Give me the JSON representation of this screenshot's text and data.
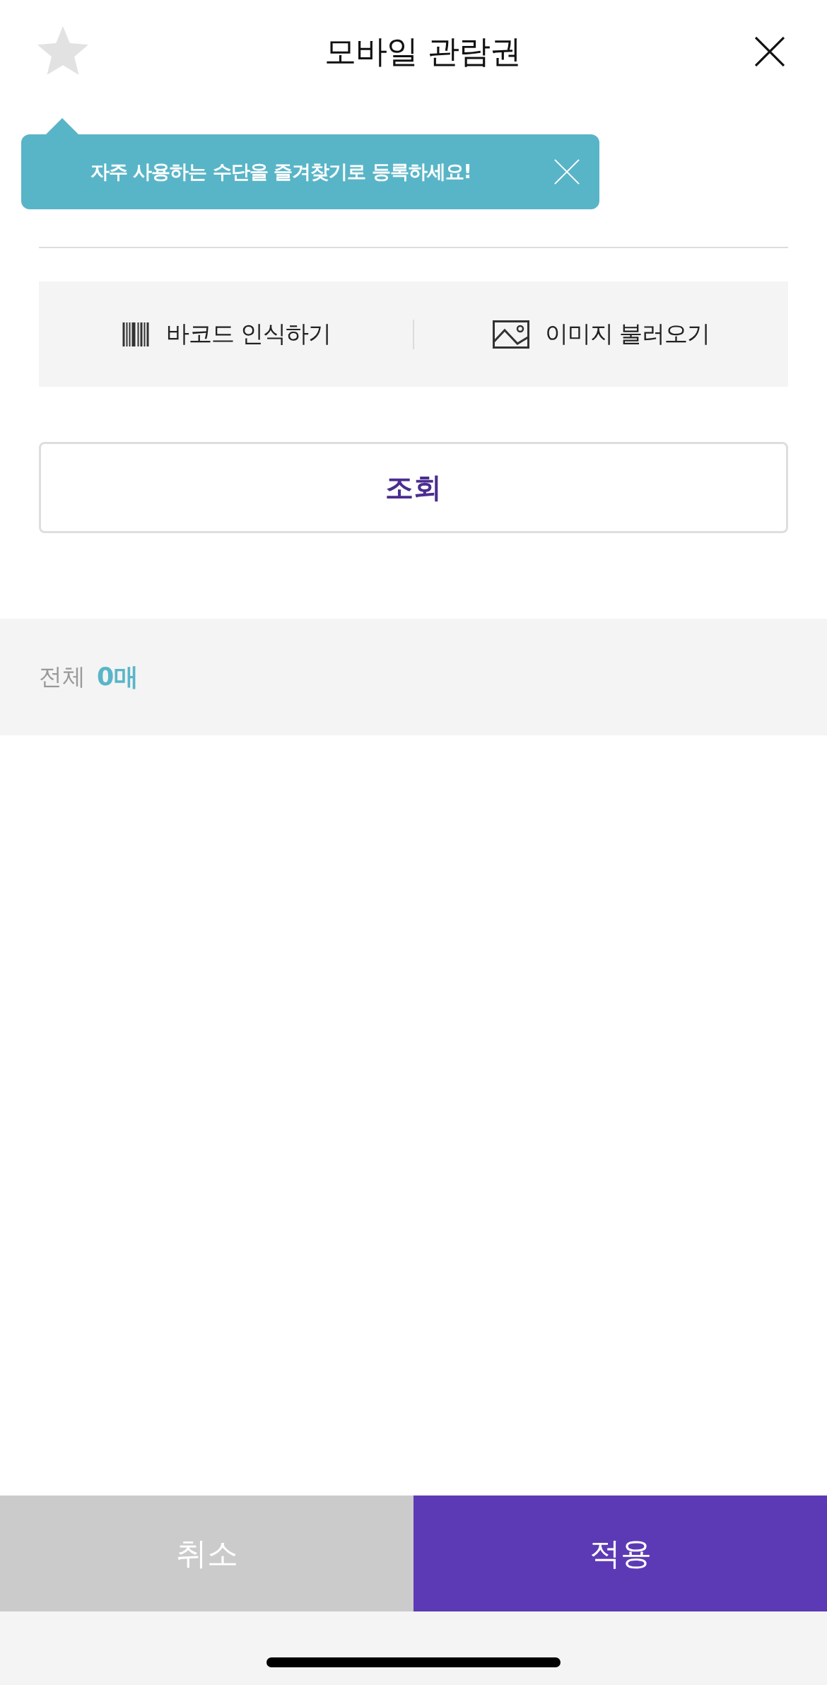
{
  "header": {
    "title": "모바일 관람권",
    "starred": false
  },
  "tooltip": {
    "text": "자주 사용하는 수단을 즐겨찾기로 등록하세요!"
  },
  "actions": [
    {
      "kind": "barcode",
      "label": "바코드 인식하기"
    },
    {
      "kind": "image",
      "label": "이미지 불러오기"
    }
  ],
  "lookup_button": {
    "label": "조회"
  },
  "summary": {
    "label": "전체",
    "count": "0매"
  },
  "footer_buttons": [
    {
      "kind": "secondary",
      "label": "취소"
    },
    {
      "kind": "primary",
      "label": "적용"
    }
  ]
}
